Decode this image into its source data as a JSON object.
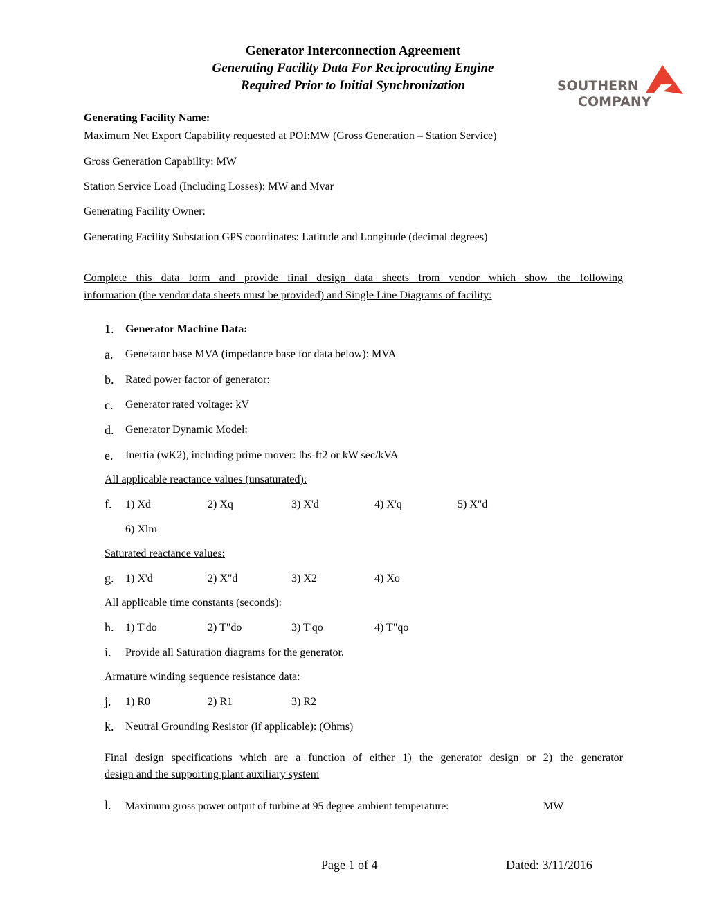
{
  "header": {
    "title_line1": "Generator Interconnection Agreement",
    "title_line2": "Generating Facility Data For Reciprocating Engine",
    "title_line3": "Required Prior to Initial Synchronization",
    "logo": {
      "name": "Southern Company logo",
      "line1": "SOUTHERN",
      "line2": "COMPANY",
      "text_color": "#6d6462",
      "mark_color": "#e8402f"
    }
  },
  "facility": {
    "name_label": "Generating Facility Name:",
    "max_net_export": "Maximum Net Export Capability requested at POI:MW (Gross Generation – Station Service)",
    "gross_generation": "Gross Generation Capability:  MW",
    "station_service": "Station Service Load (Including Losses):   MW and  Mvar",
    "owner": "Generating Facility Owner:",
    "gps": "Generating Facility Substation GPS coordinates: Latitude  and Longitude  (decimal degrees)"
  },
  "instructions": {
    "line1": "Complete this data form and provide final design data sheets from vendor which show the following",
    "line2": "information (the vendor data sheets must be provided) and Single Line Diagrams of facility:"
  },
  "section1": {
    "number": "1.",
    "title": "Generator Machine Data:",
    "items": [
      {
        "marker": "a.",
        "text": "Generator base MVA (impedance base for data below):  MVA"
      },
      {
        "marker": "b.",
        "text": "Rated power factor of generator:"
      },
      {
        "marker": "c.",
        "text": "Generator rated voltage:  kV"
      },
      {
        "marker": "d.",
        "text": "Generator Dynamic Model:"
      },
      {
        "marker": "e.",
        "text": "Inertia (wK2), including prime mover:  lbs-ft2 or  kW sec/kVA"
      }
    ],
    "unsaturated_heading": "All applicable reactance values (unsaturated):",
    "f": {
      "marker": "f.",
      "values": [
        "1)  Xd",
        "2)  Xq",
        "3)  X'd",
        "4)  X'q",
        "5)  X\"d",
        "6)  Xlm"
      ]
    },
    "saturated_heading": "Saturated reactance values:",
    "g": {
      "marker": "g.",
      "values": [
        "1)  X'd",
        "2)  X\"d",
        "3)  X2",
        "4)  Xo"
      ]
    },
    "time_constants_heading": "All applicable time constants (seconds):",
    "h": {
      "marker": "h.",
      "values": [
        "1)  T'do",
        "2)  T\"do",
        "3)  T'qo",
        "4)  T\"qo"
      ]
    },
    "i": {
      "marker": "i.",
      "text": "Provide all Saturation diagrams for the generator."
    },
    "armature_heading": "Armature winding sequence resistance data:",
    "j": {
      "marker": "j.",
      "values": [
        "1)  R0",
        "2)  R1",
        "3)  R2"
      ]
    },
    "k": {
      "marker": "k.",
      "text": "Neutral Grounding Resistor (if applicable):  (Ohms)"
    },
    "final_design_line1": "Final design specifications which are a function of either 1) the generator design or 2) the generator",
    "final_design_line2": "design and the supporting plant auxiliary system",
    "l": {
      "marker": "l.",
      "text": "Maximum gross power output of turbine at 95 degree ambient temperature:",
      "unit": "MW"
    }
  },
  "footer": {
    "page": "Page 1 of 4",
    "dated": "Dated: 3/11/2016"
  }
}
